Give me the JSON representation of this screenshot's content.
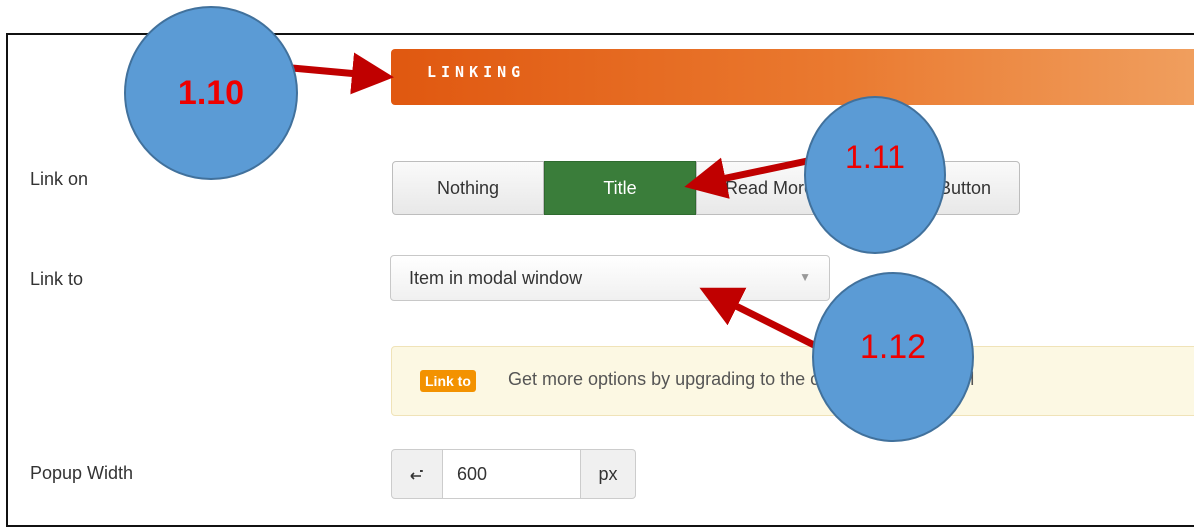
{
  "section": {
    "title": "LINKING"
  },
  "link_on": {
    "label": "Link on",
    "options": [
      "Nothing",
      "Title",
      "Read More",
      "Button"
    ],
    "selected": "Title"
  },
  "link_to": {
    "label": "Link to",
    "value": "Item in modal window"
  },
  "notice": {
    "badge": "Link to",
    "text": "Get more options by upgrading to the commercial version l"
  },
  "popup_width": {
    "label": "Popup Width",
    "icon": "resize-horizontal-icon",
    "value": "600",
    "unit": "px"
  },
  "callouts": {
    "c1": "1.10",
    "c2": "1.11",
    "c3": "1.12"
  },
  "colors": {
    "header_orange": "#e05810",
    "active_green": "#3a7d3a",
    "badge_orange": "#f39200",
    "callout_blue": "#5b9bd5",
    "callout_text_red": "#e00000",
    "arrow_red": "#c00000"
  }
}
